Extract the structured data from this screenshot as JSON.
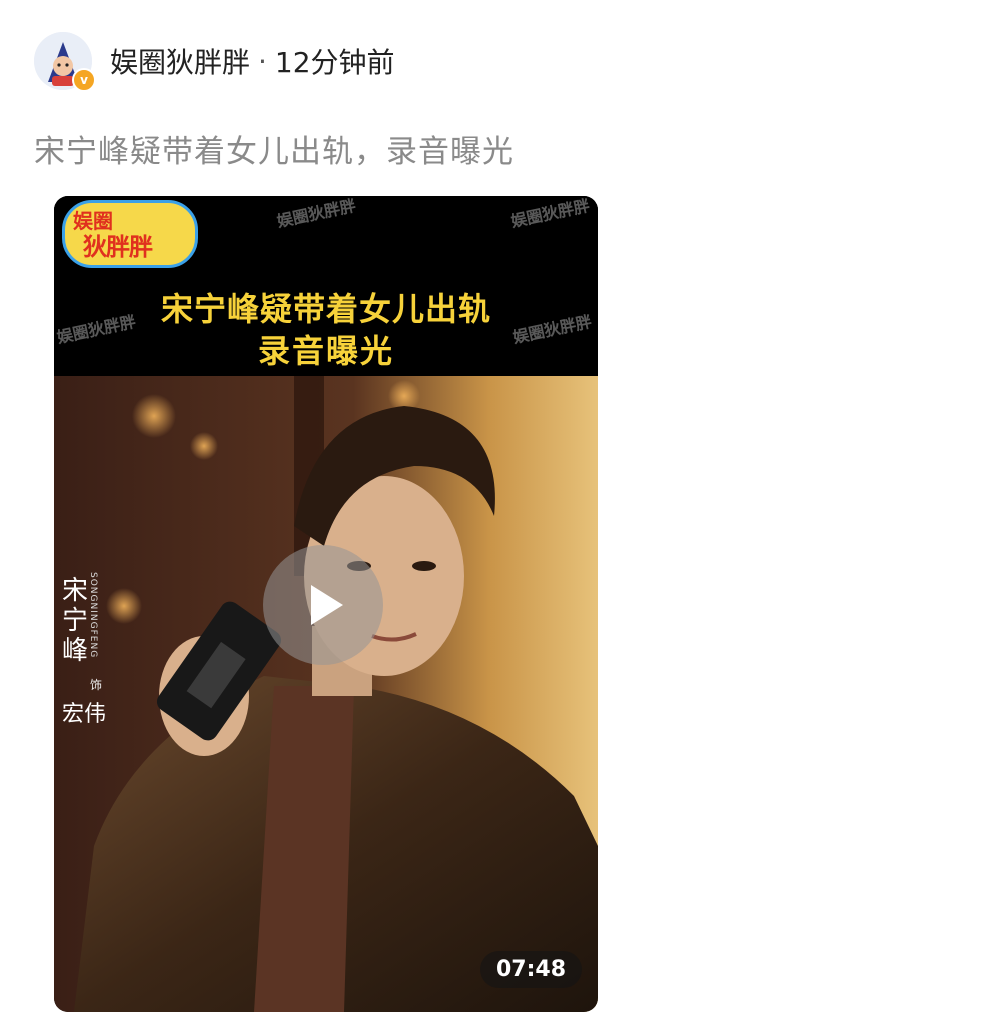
{
  "post": {
    "author": "娱圈狄胖胖",
    "separator": "·",
    "time": "12分钟前",
    "verified_badge": "v",
    "caption": "宋宁峰疑带着女儿出轨，录音曝光"
  },
  "video": {
    "logo_line1": "娱圈",
    "logo_line2": "狄胖胖",
    "watermark": "娱圈狄胖胖",
    "title_line1": "宋宁峰疑带着女儿出轨",
    "title_line2": "录音曝光",
    "role_name": "宋宁峰",
    "role_pinyin": "SONGNINGFENG",
    "role_as": "饰",
    "role_character": "宏伟",
    "duration": "07:48"
  },
  "colors": {
    "title_yellow": "#f7d23a",
    "caption_gray": "#8a8a8a",
    "badge_orange": "#f5a623"
  }
}
